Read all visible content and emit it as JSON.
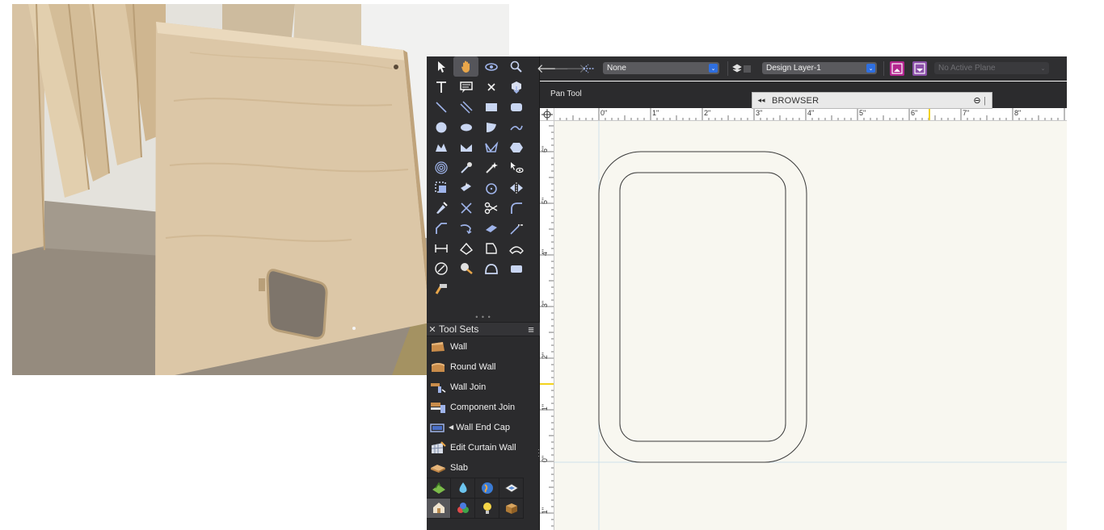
{
  "photo": {
    "subject_icon": "plywood-panel-photo"
  },
  "cad": {
    "palette": {
      "tool_icons": [
        "selection-icon",
        "pan-hand-icon",
        "flyover-icon",
        "zoom-icon",
        "text-icon",
        "callout-icon",
        "locus-icon",
        "3d-locus-icon",
        "line-icon",
        "double-line-icon",
        "rectangle-icon",
        "rounded-rectangle-icon",
        "circle-icon",
        "oval-icon",
        "arc-icon",
        "freehand-icon",
        "polyline-icon",
        "double-polyline-icon",
        "polygon-icon",
        "regular-polygon-icon",
        "spiral-icon",
        "eyedropper-icon",
        "magic-wand-icon",
        "visibility-icon",
        "offset-icon",
        "move-icon",
        "rotate-icon",
        "mirror-icon",
        "reshape-icon",
        "split-icon",
        "trim-icon",
        "fillet-icon",
        "chamfer-icon",
        "connect-icon",
        "eraser-icon",
        "clip-icon",
        "dimension-icon",
        "angular-dimension-icon",
        "arc-length-icon",
        "protractor-icon",
        "attribute-mapping-icon",
        "tape-measure-icon",
        "protractor-measure-icon",
        "sheet-border-icon",
        "hammer-icon"
      ],
      "toolsets_header": {
        "title": "Tool Sets",
        "close_glyph": "✕",
        "menu_glyph": "≡"
      },
      "toolset_items": [
        {
          "label": "Wall",
          "icon": "wall-icon"
        },
        {
          "label": "Round Wall",
          "icon": "round-wall-icon"
        },
        {
          "label": "Wall Join",
          "icon": "wall-join-icon"
        },
        {
          "label": "Component Join",
          "icon": "component-join-icon"
        },
        {
          "label": "Wall End Cap",
          "icon": "wall-end-cap-icon"
        },
        {
          "label": "Edit Curtain Wall",
          "icon": "edit-curtain-wall-icon"
        },
        {
          "label": "Slab",
          "icon": "slab-icon"
        }
      ],
      "bottom_icons": [
        "site-planning-icon",
        "landscape-water-icon",
        "globe-icon",
        "visualization-icon",
        "building-shell-icon",
        "render-color-icon",
        "lighting-icon",
        "furniture-icon"
      ]
    },
    "topbar": {
      "class_select": "None",
      "layer_select": "Design Layer-1",
      "plane_select": "No Active Plane"
    },
    "modebar": {
      "mode_label": "Pan Tool"
    },
    "browser_panel": {
      "collapse_glyph": "◂◂",
      "title": "BROWSER"
    },
    "ruler_top": [
      "0\"",
      "1\"",
      "2\"",
      "3\"",
      "4\"",
      "5\"",
      "6\"",
      "7\"",
      "8\""
    ],
    "ruler_left": [
      "6\"",
      "5\"",
      "4\"",
      "3\"",
      "2\"",
      "1\"",
      "0\"",
      "1\""
    ],
    "colors": {
      "ui_dark": "#2b2b2d",
      "accent_blue": "#2f6fe0",
      "canvas": "#f8f7f0",
      "highlight_magenta": "#b3268f"
    }
  }
}
